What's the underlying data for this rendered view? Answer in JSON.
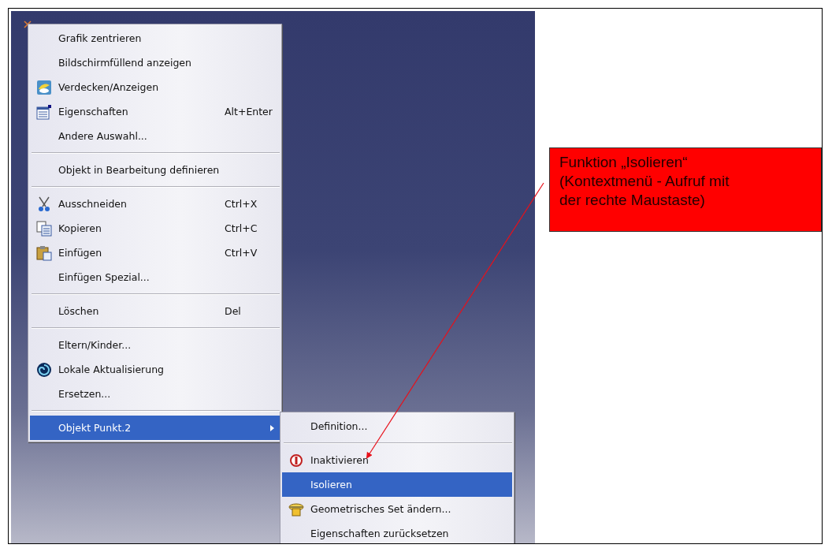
{
  "context_menu": {
    "items": [
      {
        "kind": "item",
        "label": "Grafik zentrieren",
        "selected": false
      },
      {
        "kind": "item",
        "label": "Bildschirmfüllend anzeigen",
        "selected": false
      },
      {
        "kind": "item",
        "label": "Verdecken/Anzeigen",
        "selected": false
      },
      {
        "kind": "item",
        "label": "Eigenschaften",
        "shortcut": "Alt+Enter",
        "selected": false
      },
      {
        "kind": "item",
        "label": "Andere Auswahl...",
        "selected": false
      },
      {
        "kind": "separator"
      },
      {
        "kind": "item",
        "label": "Objekt in Bearbeitung definieren",
        "selected": false
      },
      {
        "kind": "separator"
      },
      {
        "kind": "item",
        "label": "Ausschneiden",
        "shortcut": "Ctrl+X",
        "selected": false
      },
      {
        "kind": "item",
        "label": "Kopieren",
        "shortcut": "Ctrl+C",
        "selected": false
      },
      {
        "kind": "item",
        "label": "Einfügen",
        "shortcut": "Ctrl+V",
        "selected": false
      },
      {
        "kind": "item",
        "label": "Einfügen Spezial...",
        "selected": false
      },
      {
        "kind": "separator"
      },
      {
        "kind": "item",
        "label": "Löschen",
        "shortcut": "Del",
        "selected": false
      },
      {
        "kind": "separator"
      },
      {
        "kind": "item",
        "label": "Eltern/Kinder...",
        "selected": false
      },
      {
        "kind": "item",
        "label": "Lokale Aktualisierung",
        "selected": false
      },
      {
        "kind": "item",
        "label": "Ersetzen...",
        "selected": false
      },
      {
        "kind": "separator"
      },
      {
        "kind": "submenu",
        "label": "Objekt Punkt.2",
        "selected": true
      }
    ]
  },
  "submenu": {
    "items": [
      {
        "kind": "item",
        "label": "Definition...",
        "selected": false
      },
      {
        "kind": "separator"
      },
      {
        "kind": "item",
        "label": "Inaktivieren",
        "selected": false
      },
      {
        "kind": "item",
        "label": "Isolieren",
        "selected": true
      },
      {
        "kind": "item",
        "label": "Geometrisches Set ändern...",
        "selected": false
      },
      {
        "kind": "item",
        "label": "Eigenschaften zurücksetzen",
        "selected": false
      }
    ]
  },
  "callout": {
    "lines": [
      "Funktion „Isolieren“",
      "(Kontextmenü - Aufruf mit",
      "der rechte Maustaste)"
    ]
  }
}
